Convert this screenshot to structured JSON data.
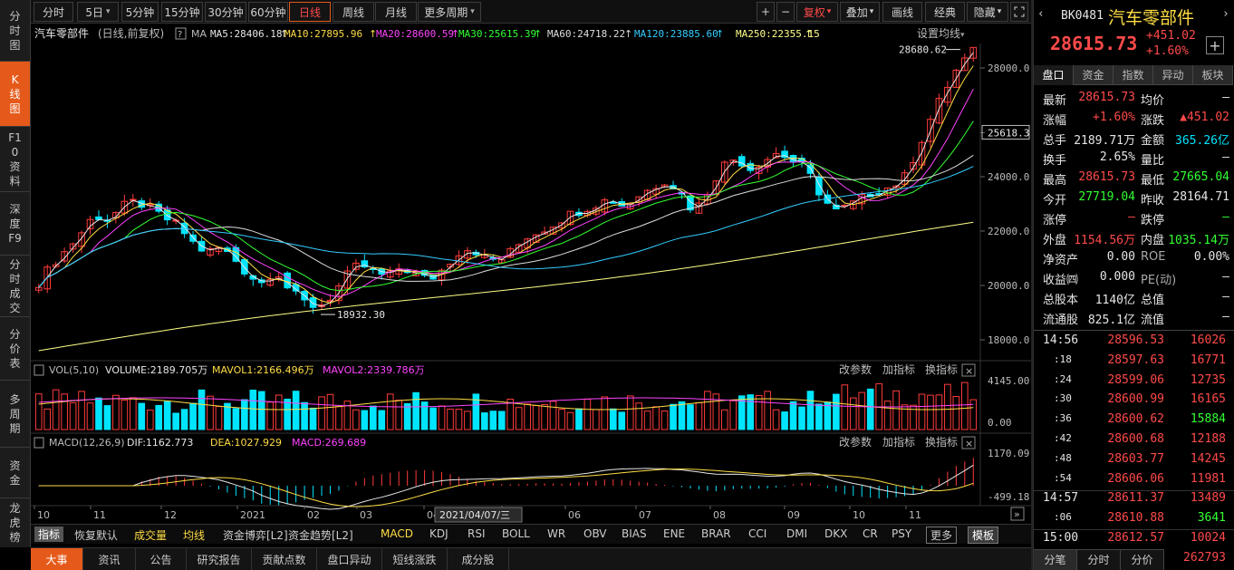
{
  "left_nav": [
    {
      "label": "分时图"
    },
    {
      "label": "K线图",
      "active": true
    },
    {
      "label": "F10资料"
    },
    {
      "label": "深度F9"
    },
    {
      "label": "分时成交"
    },
    {
      "label": "分价表"
    },
    {
      "label": "多周期"
    },
    {
      "label": "资金"
    },
    {
      "label": "龙虎榜"
    }
  ],
  "toolbar": {
    "periods": [
      "分时",
      "5日",
      "5分钟",
      "15分钟",
      "30分钟",
      "60分钟",
      "日线",
      "周线",
      "月线",
      "更多周期"
    ],
    "active_period": "日线",
    "right": [
      "+",
      "−",
      "复权",
      "叠加",
      "画线",
      "经典",
      "隐藏"
    ],
    "dropdown_mark": "▾"
  },
  "ma_legend": {
    "title": "汽车零部件",
    "sub": "(日线,前复权)",
    "q": "?",
    "ma": "MA",
    "items": [
      {
        "text": "MA5:28406.18",
        "color": "#e6e6e6"
      },
      {
        "text": "MA10:27895.96",
        "color": "#ffdd44"
      },
      {
        "text": "MA20:28600.59",
        "color": "#ff44ff"
      },
      {
        "text": "MA30:25615.39",
        "color": "#33ff33"
      },
      {
        "text": "MA60:24718.22",
        "color": "#dddddd"
      },
      {
        "text": "MA120:23885.60",
        "color": "#33ccff"
      },
      {
        "text": "MA250:22355.15",
        "color": "#ffff88"
      }
    ],
    "settings": "设置均线"
  },
  "price_axis": [
    "28000.0",
    "25618.3",
    "24000.0",
    "22000.0",
    "20000.0",
    "18000.0"
  ],
  "annotations": {
    "high": "28680.62",
    "low": "18932.30"
  },
  "volume_legend": {
    "name": "VOL(5,10)",
    "volume": "VOLUME:2189.705万",
    "mavol1": "MAVOL1:2166.496万",
    "mavol2": "MAVOL2:2339.786万",
    "actions": [
      "改参数",
      "加指标",
      "换指标"
    ],
    "axis": [
      "4145.00",
      "0.00"
    ]
  },
  "macd_legend": {
    "name": "MACD(12,26,9)",
    "dif": "DIF:1162.773",
    "dea": "DEA:1027.929",
    "macd": "MACD:269.689",
    "actions": [
      "改参数",
      "加指标",
      "换指标"
    ],
    "axis": [
      "1170.09",
      "-499.18"
    ]
  },
  "time_axis": {
    "labels": [
      "10",
      "11",
      "12",
      "2021",
      "02",
      "03",
      "04",
      "05",
      "06",
      "07",
      "08",
      "09",
      "10",
      "11"
    ],
    "cursor": "2021/04/07/三"
  },
  "indicator_tabs": [
    "指标",
    "恢复默认",
    "成交量",
    "均线",
    "资金博弈[L2]",
    "资金趋势[L2]",
    "MACD",
    "KDJ",
    "RSI",
    "BOLL",
    "WR",
    "OBV",
    "BIAS",
    "ENE",
    "BRAR",
    "CCI",
    "DMI",
    "DKX",
    "CR",
    "PSY",
    "更多",
    "模板"
  ],
  "bottom_tabs": [
    "大事",
    "资讯",
    "公告",
    "研究报告",
    "贡献点数",
    "盘口异动",
    "短线涨跌",
    "成分股"
  ],
  "quote": {
    "code": "BK0481",
    "name": "汽车零部件",
    "price": "28615.73",
    "change": "+451.02",
    "pct": "+1.60%",
    "tabs": [
      "盘口",
      "资金",
      "指数",
      "异动",
      "板块"
    ],
    "rows": [
      [
        "最新",
        "28615.73",
        "均价",
        "—"
      ],
      [
        "涨幅",
        "+1.60%",
        "涨跌",
        "▲451.02"
      ],
      [
        "总手",
        "2189.71万",
        "金额",
        "365.26亿"
      ],
      [
        "换手",
        "2.65%",
        "量比",
        "—"
      ],
      [
        "最高",
        "28615.73",
        "最低",
        "27665.04"
      ],
      [
        "今开",
        "27719.04",
        "昨收",
        "28164.71"
      ],
      [
        "涨停",
        "—",
        "跌停",
        "—"
      ],
      [
        "外盘",
        "1154.56万",
        "内盘",
        "1035.14万"
      ],
      [
        "净资产",
        "0.00",
        "ROE",
        "0.00%"
      ],
      [
        "收益㈣",
        "0.000",
        "PE(动)",
        "—"
      ],
      [
        "总股本",
        "1140亿",
        "总值",
        "—"
      ],
      [
        "流通股",
        "825.1亿",
        "流值",
        "—"
      ]
    ],
    "ticks": [
      [
        "14:56",
        "28596.53",
        "16026"
      ],
      [
        ":18",
        "28597.63",
        "16771"
      ],
      [
        ":24",
        "28599.06",
        "12735"
      ],
      [
        ":30",
        "28600.99",
        "16165"
      ],
      [
        ":36",
        "28600.62",
        "15884"
      ],
      [
        ":42",
        "28600.68",
        "12188"
      ],
      [
        ":48",
        "28603.77",
        "14245"
      ],
      [
        ":54",
        "28606.06",
        "11981"
      ],
      [
        "14:57",
        "28611.37",
        "13489"
      ],
      [
        ":06",
        "28610.88",
        "3641"
      ],
      [
        "15:00",
        "28612.57",
        "10024"
      ],
      [
        ":59",
        "28615.73",
        "262793"
      ]
    ],
    "bottom_tabs": [
      "分笔",
      "分时",
      "分价"
    ]
  },
  "chart_data": {
    "type": "candlestick",
    "title": "汽车零部件",
    "y_range": [
      17300,
      28900
    ],
    "close_series": [
      20100,
      20800,
      21300,
      21900,
      22600,
      22400,
      22900,
      23100,
      22800,
      22500,
      22200,
      21600,
      21200,
      21400,
      21000,
      20400,
      20100,
      20600,
      19800,
      19400,
      19200,
      19600,
      20300,
      20800,
      20500,
      20300,
      20700,
      20400,
      20200,
      20600,
      21200,
      21400,
      21000,
      20900,
      21300,
      21800,
      22000,
      22300,
      22600,
      22800,
      23000,
      23200,
      22900,
      23300,
      23600,
      23900,
      23400,
      22700,
      23500,
      24400,
      24700,
      24300,
      24600,
      24900,
      24600,
      24300,
      23400,
      22700,
      22900,
      23200,
      23500,
      23600,
      23900,
      25000,
      26200,
      27200,
      28100,
      28600
    ],
    "high_label": "28680.62",
    "low_label": "18932.30",
    "last_price_label": "25618.3"
  }
}
